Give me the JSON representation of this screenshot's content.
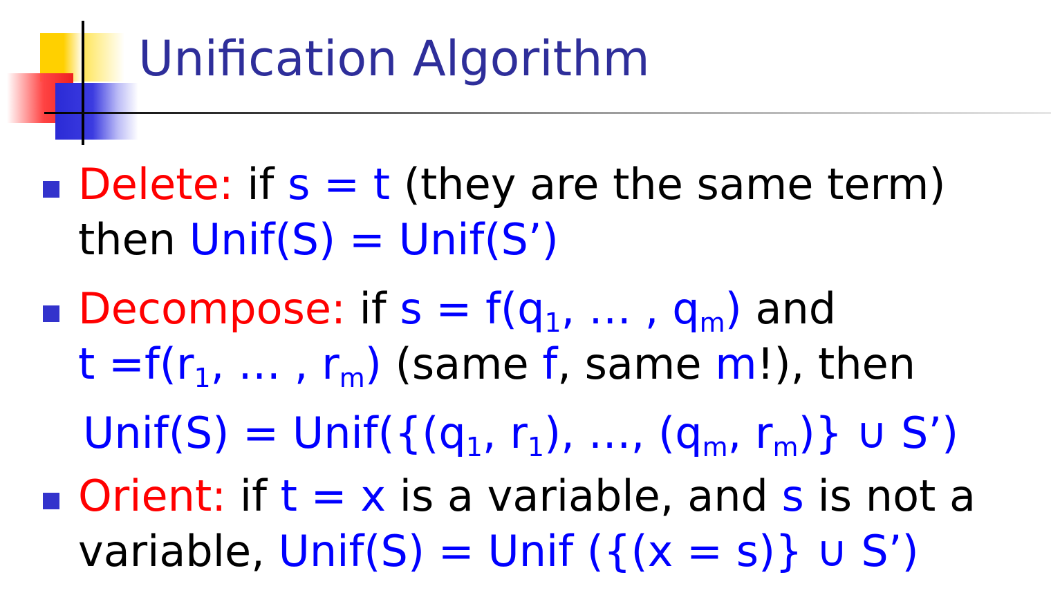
{
  "slide": {
    "title": "Unification Algorithm"
  },
  "rules": [
    {
      "name": "Delete:",
      "line1": {
        "t1": "if ",
        "e1": "s = t",
        "t2": " (they are the same term)"
      },
      "line2": {
        "t1": "then ",
        "e1": "Unif(S) = Unif(S’)"
      }
    },
    {
      "name": "Decompose:",
      "line1": {
        "t1": "if ",
        "e1": "s = f(q",
        "s1": "1",
        "e2": ", … , q",
        "s2": "m",
        "e3": ")",
        "t2": " and"
      },
      "line2": {
        "e1": "t =f(r",
        "s1": "1",
        "e2": ", … , r",
        "s2": "m",
        "e3": ")",
        "t1": " (same ",
        "e4": "f",
        "t2": ", same ",
        "e5": "m",
        "t3": "!), then"
      },
      "line3": {
        "e1": "Unif(S) = Unif({(q",
        "s1": "1",
        "e2": ", r",
        "s2": "1",
        "e3": "), …, (q",
        "s3": "m",
        "e4": ", r",
        "s4": "m",
        "e5": ")} ∪ S’)"
      }
    },
    {
      "name": "Orient:",
      "line1": {
        "t1": "if ",
        "e1": "t = x",
        "t2": " is a variable, and ",
        "e2": "s",
        "t3": " is not a"
      },
      "line2": {
        "t1": "variable, ",
        "e1": "Unif(S) = Unif ({(x = s)} ∪ S’)"
      }
    }
  ],
  "colors": {
    "title": "#2e2e9a",
    "keyword": "#ff0000",
    "expression": "#0000ff",
    "text": "#000000",
    "bullet": "#3333cc"
  }
}
